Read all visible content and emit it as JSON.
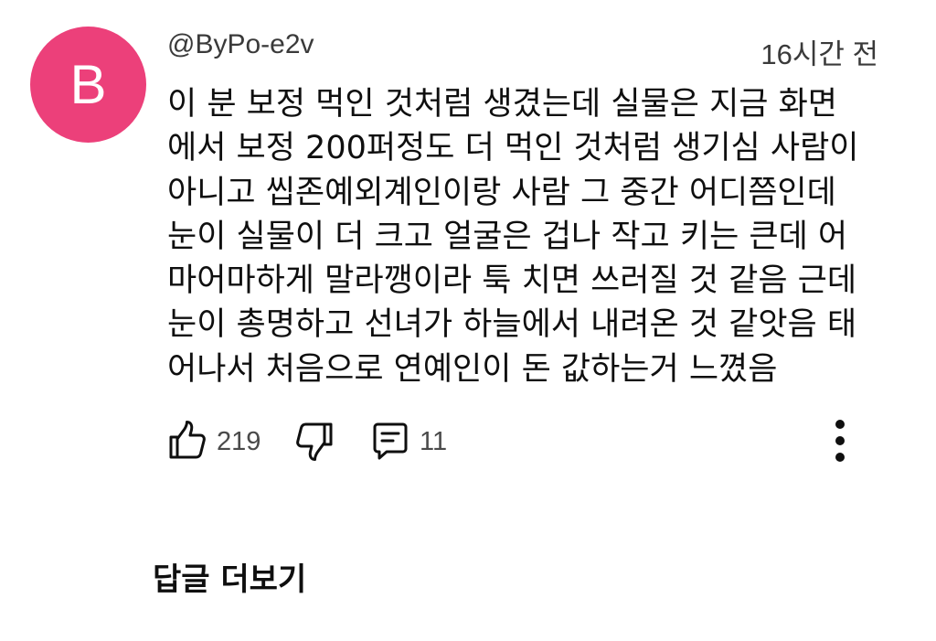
{
  "comment": {
    "avatar_letter": "B",
    "avatar_color": "#ec407a",
    "username": "@ByPo-e2v",
    "timestamp": "16시간 전",
    "lines": [
      "이 분 보정 먹인 것처럼 생겼는데 실물은 지금 화면",
      "에서 보정 200퍼정도 더 먹인 것처럼 생기심 사람이",
      "아니고 씹존예외계인이랑 사람 그 중간 어디쯤인데",
      "눈이 실물이 더 크고 얼굴은 겁나 작고 키는 큰데 어",
      "마어마하게 말라깽이라 툭 치면 쓰러질 것 같음 근데",
      "눈이 총명하고 선녀가 하늘에서 내려온 것 같앗음 태",
      "어나서 처음으로 연예인이 돈 값하는거 느꼈음"
    ]
  },
  "actions": {
    "like_icon": "thumbs-up-icon",
    "like_count": "219",
    "dislike_icon": "thumbs-down-icon",
    "reply_icon": "comment-icon",
    "reply_count": "11",
    "more_icon": "more-vertical-icon"
  },
  "replies": {
    "label": "답글 더보기"
  }
}
